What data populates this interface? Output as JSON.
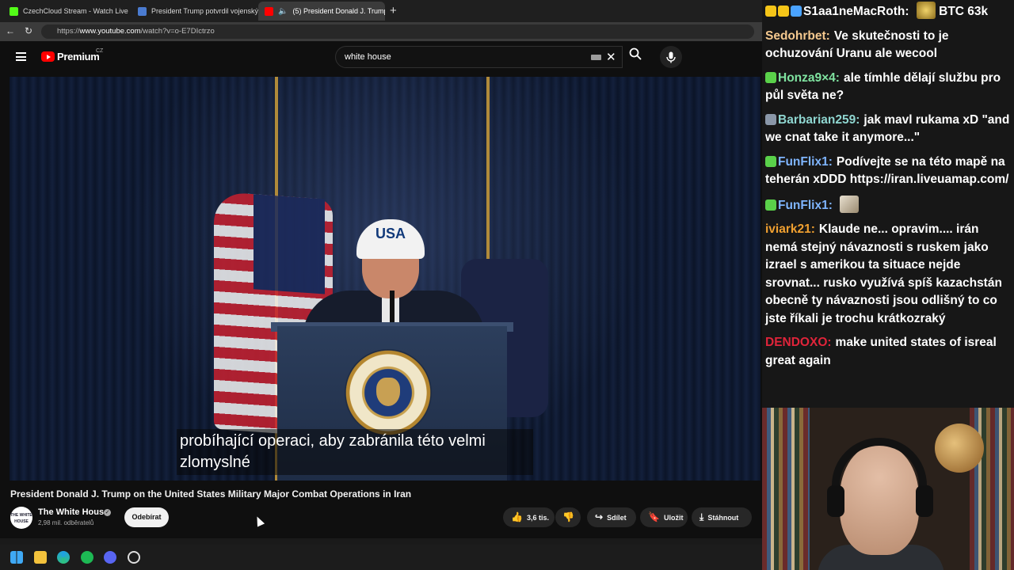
{
  "browser": {
    "tabs": [
      {
        "label": "CzechCloud Stream - Watch Live o",
        "favicon_color": "#53fc18",
        "active": false
      },
      {
        "label": "President Trump potvrdil vojenský",
        "favicon_color": "#4a7bd0",
        "active": false
      },
      {
        "label": "(5) President Donald J. Trump",
        "favicon_color": "#ff0000",
        "active": true
      }
    ],
    "url_prefix": "https://",
    "url_host": "www.youtube.com",
    "url_path": "/watch?v=o-E7DIctrzo"
  },
  "youtube": {
    "brand": "Premium",
    "region": "CZ",
    "search_value": "white house",
    "video": {
      "cap_text": "USA",
      "subtitle_line1": "probíhající operaci, aby zabránila této velmi",
      "subtitle_line2": "zlomyslné",
      "title": "President Donald J. Trump on the United States Military Major Combat Operations in Iran"
    },
    "channel": {
      "name": "The White House",
      "avatar_text": "THE WHITE HOUSE",
      "subscribers": "2,98 mil. odběratelů",
      "subscribe_label": "Odebírat"
    },
    "actions": {
      "likes": "3,6 tis.",
      "share": "Sdílet",
      "save": "Uložit",
      "download": "Stáhnout"
    }
  },
  "chat": {
    "messages": [
      {
        "user": "S1aa1neMacRoth:",
        "user_color": "#ffffff",
        "text": "BTC 63k",
        "badges": [
          "#f5c518",
          "#f5c518",
          "#4aa3ff"
        ],
        "emote": true
      },
      {
        "user": "Sedohrbet:",
        "user_color": "#f5c98f",
        "text": "Ve skutečnosti to je ochuzování Uranu ale wecool",
        "badges": []
      },
      {
        "user": "Honza9×4:",
        "user_color": "#7fe3a0",
        "text": "ale tímhle dělají službu pro půl světa ne?",
        "badges": [
          "#5ad14a"
        ]
      },
      {
        "user": "Barbarian259:",
        "user_color": "#8fd6d0",
        "text": "jak mavl rukama xD \"and we cnat take it anymore...\"",
        "badges": [
          "#8a97a8"
        ]
      },
      {
        "user": "FunFlix1:",
        "user_color": "#7fb5ff",
        "text": "Podívejte se na této mapě na teherán xDDD https://iran.liveuamap.com/",
        "badges": [
          "#5ad14a"
        ]
      },
      {
        "user": "FunFlix1:",
        "user_color": "#7fb5ff",
        "text": "",
        "badges": [
          "#5ad14a"
        ],
        "emote": true
      },
      {
        "user": "iviark21:",
        "user_color": "#f0a030",
        "text": "Klaude ne... opravim.... irán nemá stejný návaznosti s ruskem jako izrael s amerikou ta situace nejde srovnat... rusko využívá spíš kazachstán obecně ty návaznosti jsou odlišný to co jste říkali je trochu krátkozraký",
        "badges": []
      },
      {
        "user": "DENDOXO:",
        "user_color": "#e0243a",
        "text": "make united states of isreal great again",
        "badges": []
      }
    ]
  },
  "colors": {
    "page_bg": "#0f0f0f",
    "chat_bg": "#171717",
    "accent_red": "#ff0000"
  }
}
